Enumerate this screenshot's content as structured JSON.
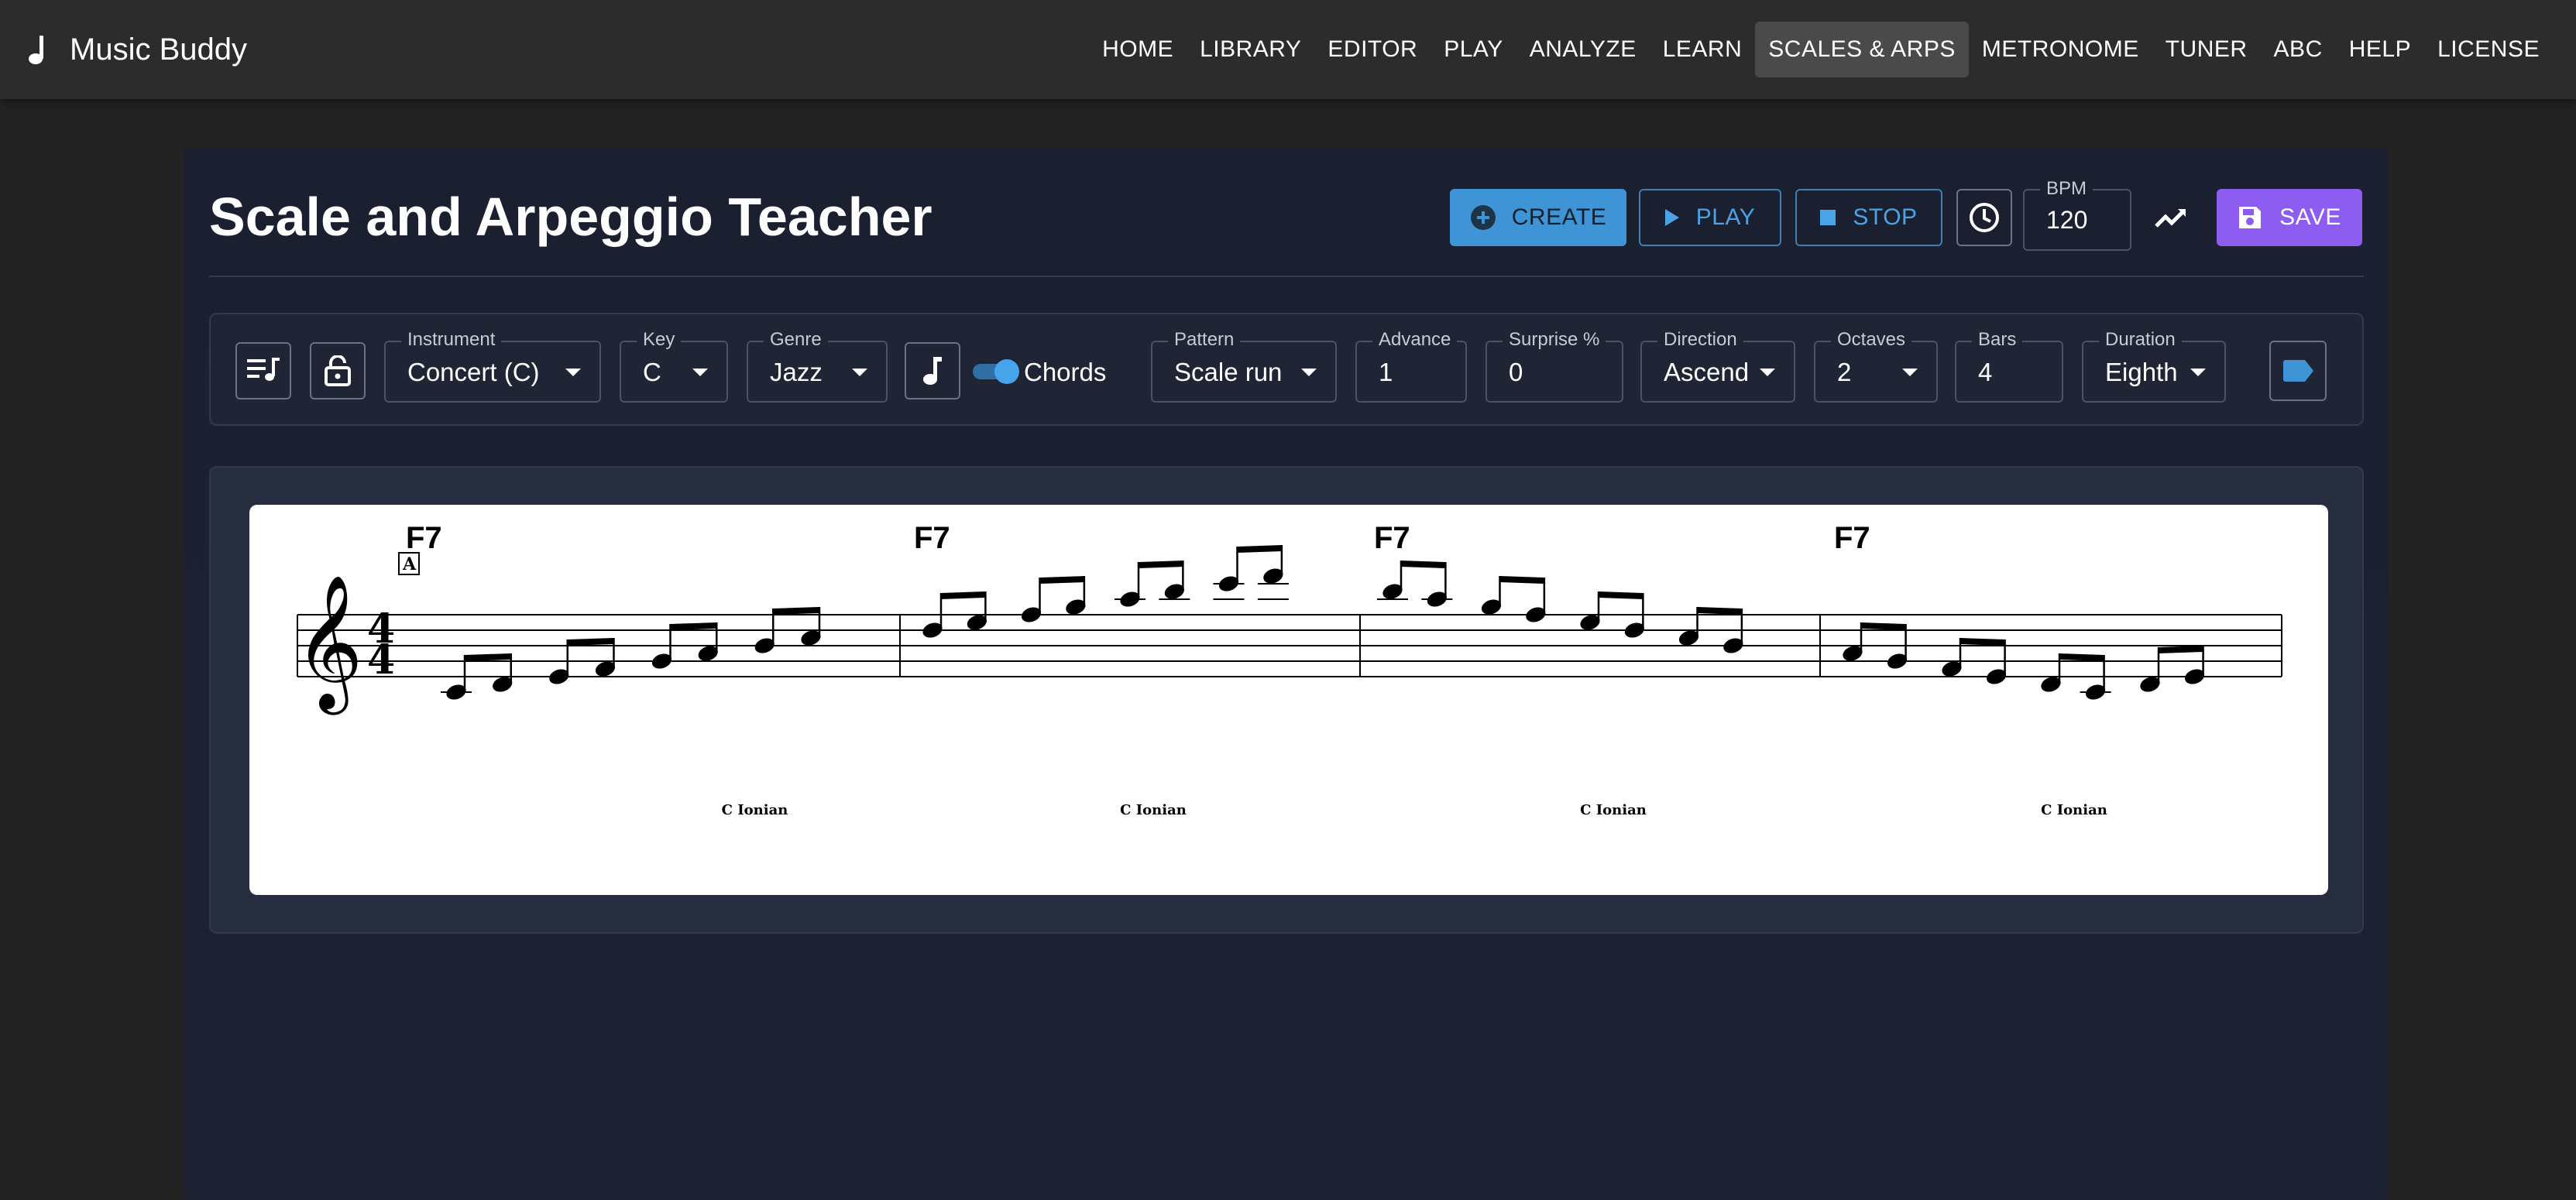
{
  "app": {
    "title": "Music Buddy",
    "logo_icon": "music-note-icon"
  },
  "nav": [
    {
      "key": "home",
      "label": "HOME",
      "active": false
    },
    {
      "key": "library",
      "label": "LIBRARY",
      "active": false
    },
    {
      "key": "editor",
      "label": "EDITOR",
      "active": false
    },
    {
      "key": "play",
      "label": "PLAY",
      "active": false
    },
    {
      "key": "analyze",
      "label": "ANALYZE",
      "active": false
    },
    {
      "key": "learn",
      "label": "LEARN",
      "active": false
    },
    {
      "key": "scales",
      "label": "SCALES & ARPS",
      "active": true
    },
    {
      "key": "metronome",
      "label": "METRONOME",
      "active": false
    },
    {
      "key": "tuner",
      "label": "TUNER",
      "active": false
    },
    {
      "key": "abc",
      "label": "ABC",
      "active": false
    },
    {
      "key": "help",
      "label": "HELP",
      "active": false
    },
    {
      "key": "license",
      "label": "LICENSE",
      "active": false
    }
  ],
  "page": {
    "title": "Scale and Arpeggio Teacher"
  },
  "toolbar": {
    "create_label": "CREATE",
    "play_label": "PLAY",
    "stop_label": "STOP",
    "bpm_label": "BPM",
    "bpm_value": "120",
    "save_label": "SAVE",
    "colors": {
      "create": "#3f94d6",
      "outline": "#4aa3e6",
      "save": "#8d5cf0"
    }
  },
  "controls": {
    "instrument": {
      "label": "Instrument",
      "value": "Concert (C)"
    },
    "key": {
      "label": "Key",
      "value": "C"
    },
    "genre": {
      "label": "Genre",
      "value": "Jazz"
    },
    "chords_toggle": {
      "label": "Chords",
      "on": true
    },
    "pattern": {
      "label": "Pattern",
      "value": "Scale run"
    },
    "advance": {
      "label": "Advance",
      "value": "1"
    },
    "surprise": {
      "label": "Surprise %",
      "value": "0"
    },
    "direction": {
      "label": "Direction",
      "value": "Ascend"
    },
    "octaves": {
      "label": "Octaves",
      "value": "2"
    },
    "bars": {
      "label": "Bars",
      "value": "4"
    },
    "duration": {
      "label": "Duration",
      "value": "Eighth"
    }
  },
  "score": {
    "rehearsal_mark": "A",
    "time_signature": {
      "top": "4",
      "bottom": "4"
    },
    "measures": [
      {
        "chord": "F7",
        "scale": "C Ionian",
        "notes": [
          "C4",
          "D4",
          "E4",
          "F4",
          "G4",
          "A4",
          "B4",
          "C5"
        ]
      },
      {
        "chord": "F7",
        "scale": "C Ionian",
        "notes": [
          "D5",
          "E5",
          "F5",
          "G5",
          "A5",
          "B5",
          "C6",
          "D6"
        ]
      },
      {
        "chord": "F7",
        "scale": "C Ionian",
        "notes": [
          "B5",
          "A5",
          "G5",
          "F5",
          "E5",
          "D5",
          "C5",
          "B4"
        ]
      },
      {
        "chord": "F7",
        "scale": "C Ionian",
        "notes": [
          "A4",
          "G4",
          "F4",
          "E4",
          "D4",
          "C4",
          "D4",
          "E4"
        ]
      }
    ]
  }
}
